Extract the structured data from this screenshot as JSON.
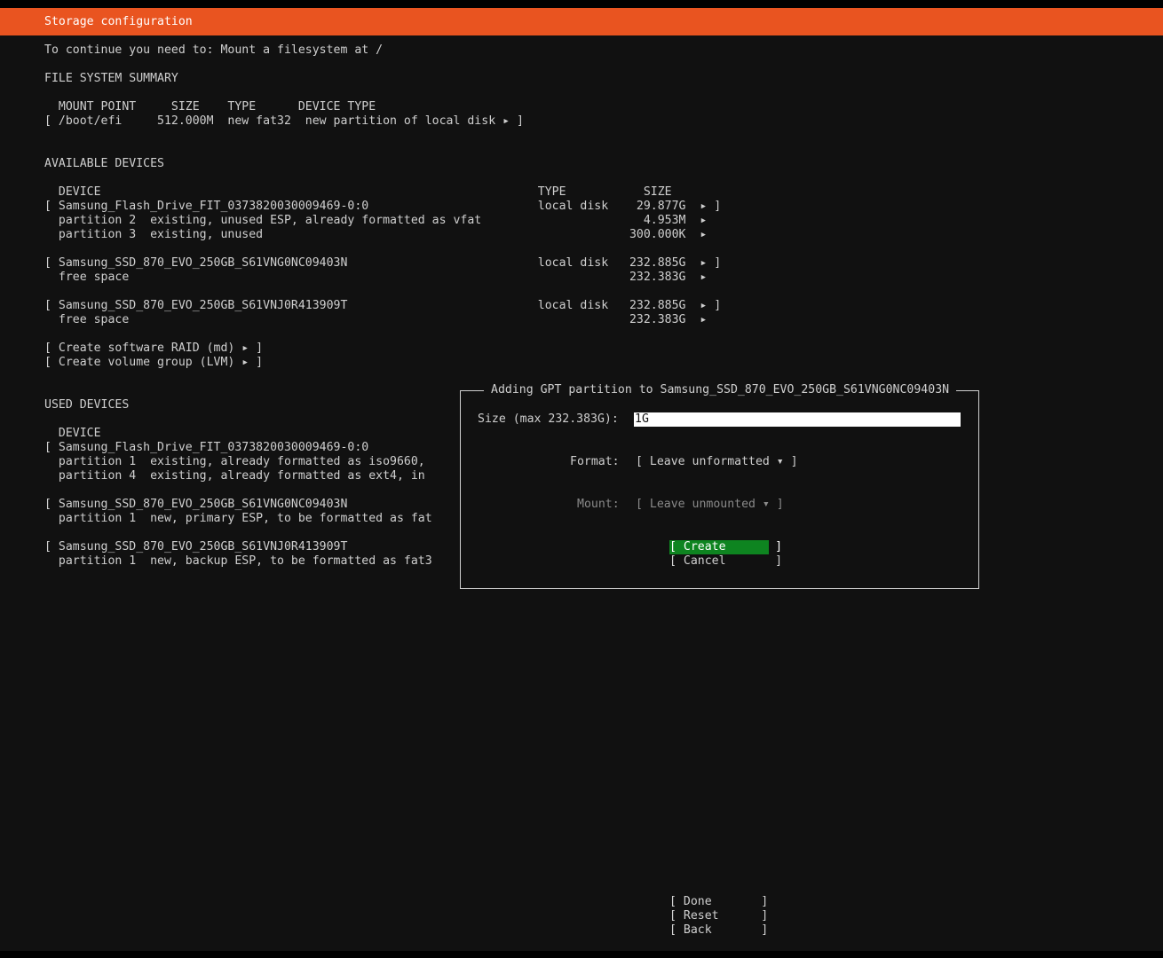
{
  "header": {
    "title": "Storage configuration"
  },
  "guidance": "To continue you need to: Mount a filesystem at /",
  "fs_summary": {
    "heading": "FILE SYSTEM SUMMARY",
    "header_row": "  MOUNT POINT     SIZE    TYPE      DEVICE TYPE",
    "rows": [
      "[ /boot/efi     512.000M  new fat32  new partition of local disk ▸ ]"
    ]
  },
  "available": {
    "heading": "AVAILABLE DEVICES",
    "header_row": "  DEVICE                                                              TYPE           SIZE",
    "lines": [
      "[ Samsung_Flash_Drive_FIT_0373820030009469-0:0                        local disk    29.877G  ▸ ]",
      "  partition 2  existing, unused ESP, already formatted as vfat                       4.953M  ▸",
      "  partition 3  existing, unused                                                    300.000K  ▸",
      "",
      "[ Samsung_SSD_870_EVO_250GB_S61VNG0NC09403N                           local disk   232.885G  ▸ ]",
      "  free space                                                                       232.383G  ▸",
      "",
      "[ Samsung_SSD_870_EVO_250GB_S61VNJ0R413909T                           local disk   232.885G  ▸ ]",
      "  free space                                                                       232.383G  ▸",
      "",
      "[ Create software RAID (md) ▸ ]",
      "[ Create volume group (LVM) ▸ ]"
    ]
  },
  "used": {
    "heading": "USED DEVICES",
    "header_row": "  DEVICE",
    "lines": [
      "[ Samsung_Flash_Drive_FIT_0373820030009469-0:0",
      "  partition 1  existing, already formatted as iso9660,",
      "  partition 4  existing, already formatted as ext4, in",
      "",
      "[ Samsung_SSD_870_EVO_250GB_S61VNG0NC09403N",
      "  partition 1  new, primary ESP, to be formatted as fat",
      "",
      "[ Samsung_SSD_870_EVO_250GB_S61VNJ0R413909T",
      "  partition 1  new, backup ESP, to be formatted as fat3"
    ]
  },
  "dialog": {
    "title": "Adding GPT partition to Samsung_SSD_870_EVO_250GB_S61VNG0NC09403N",
    "size_label": "Size (max 232.383G):",
    "size_value": "1G",
    "format_label": "Format:",
    "format_value": "[ Leave unformatted ▾ ]",
    "mount_label": "Mount:",
    "mount_value": "[ Leave unmounted ▾ ]",
    "create_button": "[ Create       ]",
    "cancel_button": "[ Cancel       ]"
  },
  "footer": {
    "done": "[ Done       ]",
    "reset": "[ Reset      ]",
    "back": "[ Back       ]"
  },
  "colors": {
    "header_bg": "#e95420",
    "focus_bg": "#0e8420",
    "background": "#111111"
  }
}
